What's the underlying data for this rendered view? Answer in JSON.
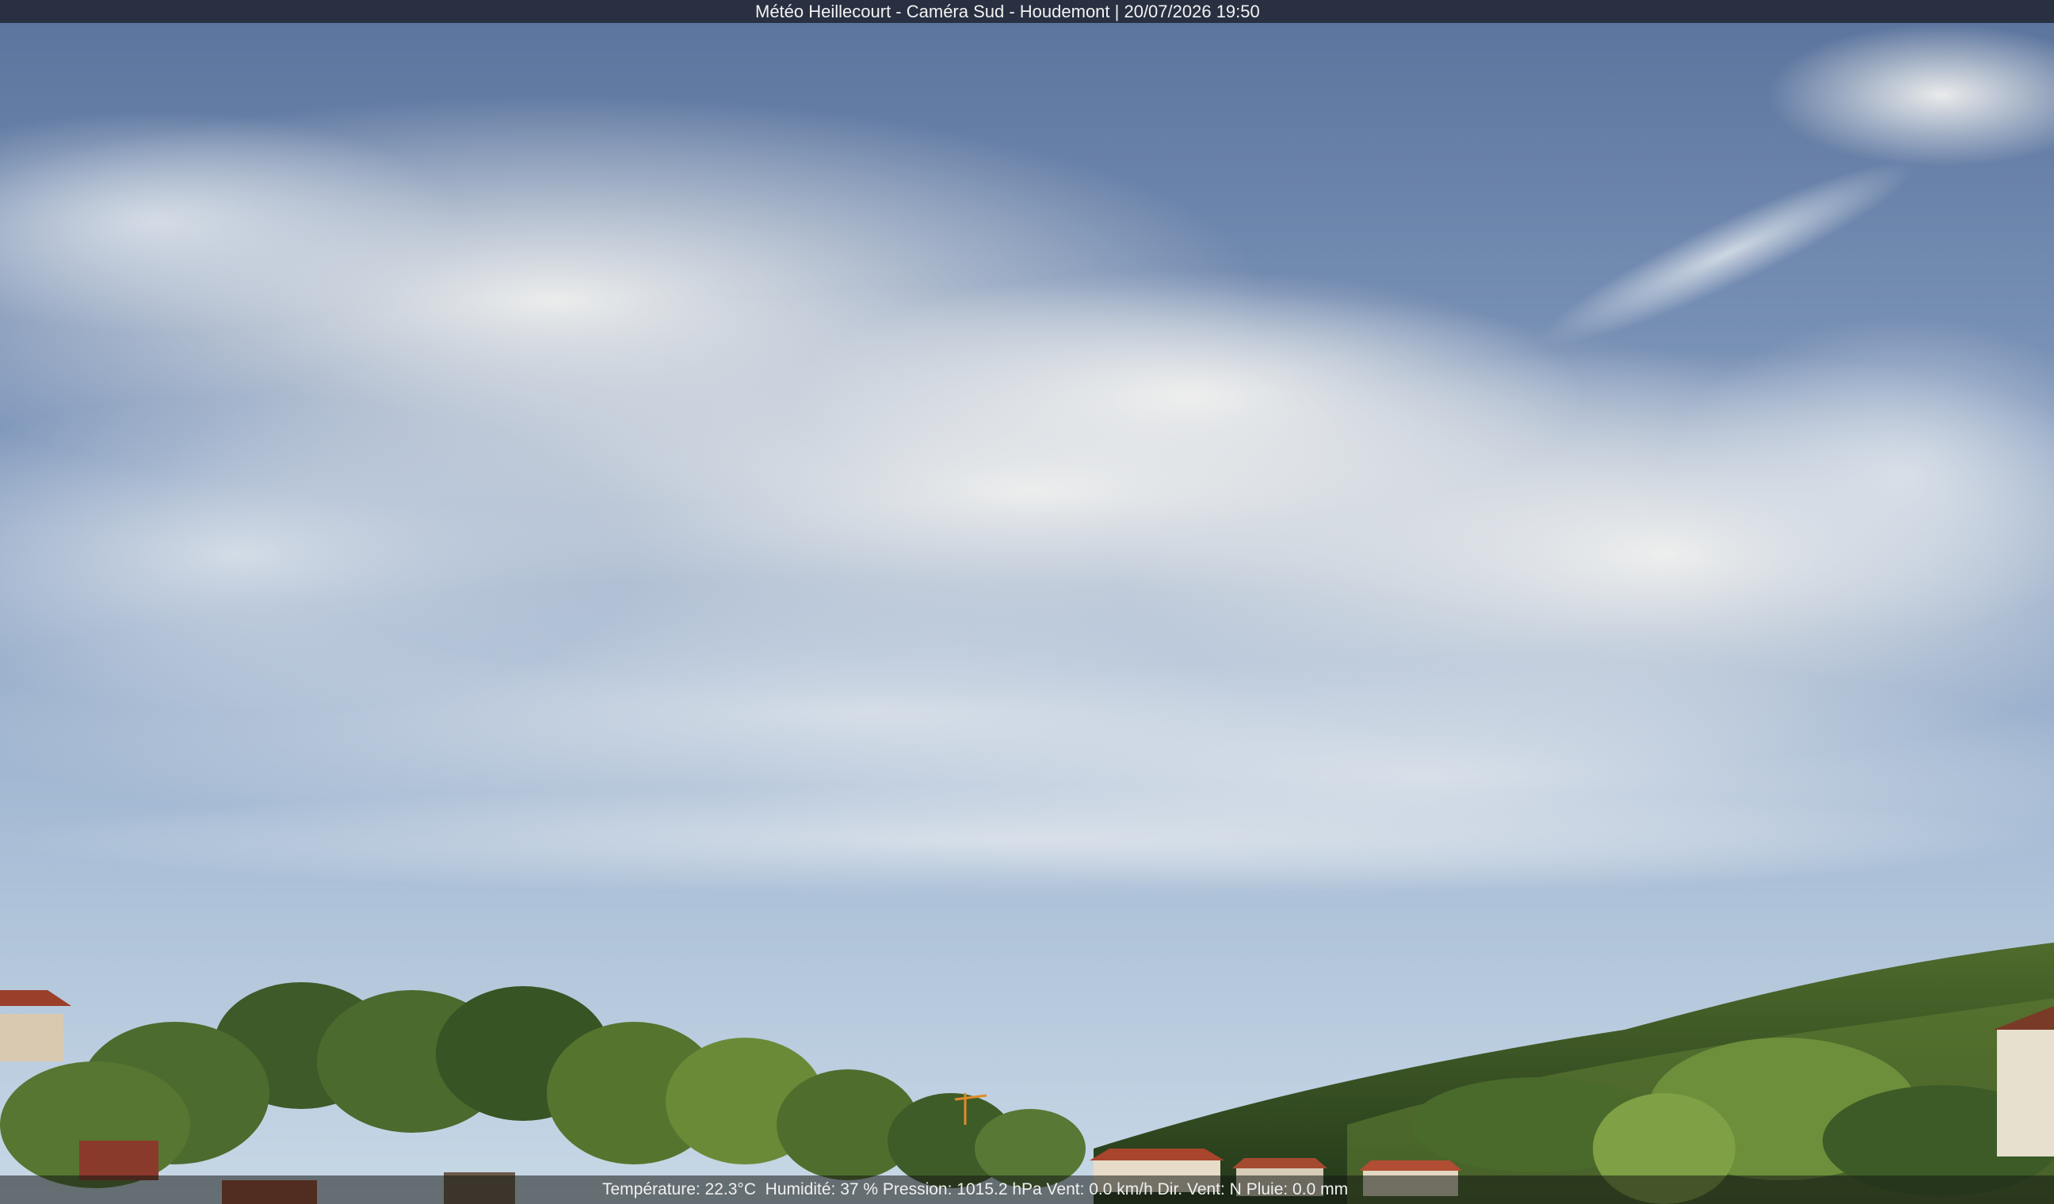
{
  "overlay": {
    "title": "Météo Heillecourt - Caméra Sud - Houdemont | 20/07/2026 19:50",
    "weather": {
      "temperature": "Température: 22.3°C ",
      "humidity": " Humidité: 37 % ",
      "pressure": "Pression: 1015.2 hPa ",
      "wind": "Vent: 0.0 km/h ",
      "wind_dir": "Dir. Vent: N ",
      "rain": "Pluie: 0.0 mm"
    }
  },
  "colors": {
    "sky_top": "#5f7aa3",
    "sky_mid": "#8fa6c6",
    "sky_horizon": "#b9cde0",
    "cloud": "#e8ecf0",
    "trees_dark": "#2f4a22",
    "trees_light": "#6f8f3a",
    "roof": "#a8452c"
  }
}
